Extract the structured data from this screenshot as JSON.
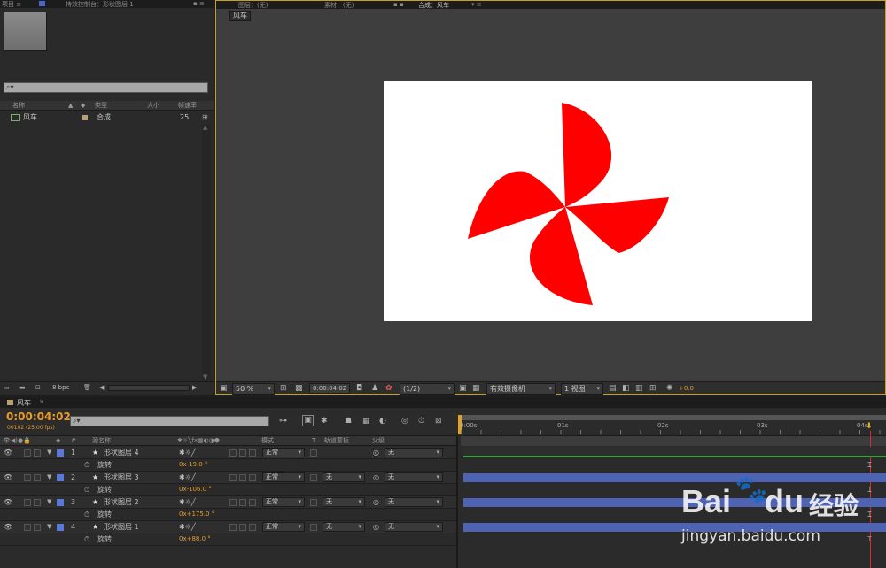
{
  "project_panel": {
    "tab_label": "项目 ≡",
    "effects_tab": "特效控制台：形状图层 1",
    "search_placeholder": "",
    "columns": [
      "名称",
      "类型",
      "大小",
      "帧速率"
    ],
    "items": [
      {
        "name": "风车",
        "type": "合成",
        "size": "",
        "fps": "25"
      }
    ],
    "bpc_label": "8 bpc"
  },
  "viewer": {
    "tabs": [
      "图层：(无)",
      "素材：(无)",
      "合成：风车"
    ],
    "comp_chip": "风车",
    "zoom": "50 %",
    "timecode": "0:00:04:02",
    "resolution": "(1/2)",
    "camera": "有效摄像机",
    "views": "1 视图",
    "exposure": "+0.0",
    "accent_color": "#ff0000",
    "canvas_color": "#ffffff"
  },
  "timeline": {
    "tab_label": "风车",
    "timecode": "0:00:04:02",
    "frame_info": "00102 (25.00 fps)",
    "header": {
      "num": "#",
      "source_name": "源名称",
      "mode": "模式",
      "t": "T",
      "trkmat": "轨道蒙板",
      "parent": "父级"
    },
    "ruler": [
      "0:00s",
      "01s",
      "02s",
      "03s",
      "04s"
    ],
    "layers": [
      {
        "num": "1",
        "name": "形状图层 4",
        "mode": "正常",
        "trkmat": "",
        "parent": "无",
        "prop": "旋转",
        "value": "0x-19.0 °"
      },
      {
        "num": "2",
        "name": "形状图层 3",
        "mode": "正常",
        "trkmat": "无",
        "parent": "无",
        "prop": "旋转",
        "value": "0x-106.0 °"
      },
      {
        "num": "3",
        "name": "形状图层 2",
        "mode": "正常",
        "trkmat": "无",
        "parent": "无",
        "prop": "旋转",
        "value": "0x+175.0 °"
      },
      {
        "num": "4",
        "name": "形状图层 1",
        "mode": "正常",
        "trkmat": "无",
        "parent": "无",
        "prop": "旋转",
        "value": "0x+88.0 °"
      }
    ]
  },
  "watermark": {
    "brand": "Bai",
    "brand2": "du",
    "brand_cn": "经验",
    "url": "jingyan.baidu.com"
  }
}
